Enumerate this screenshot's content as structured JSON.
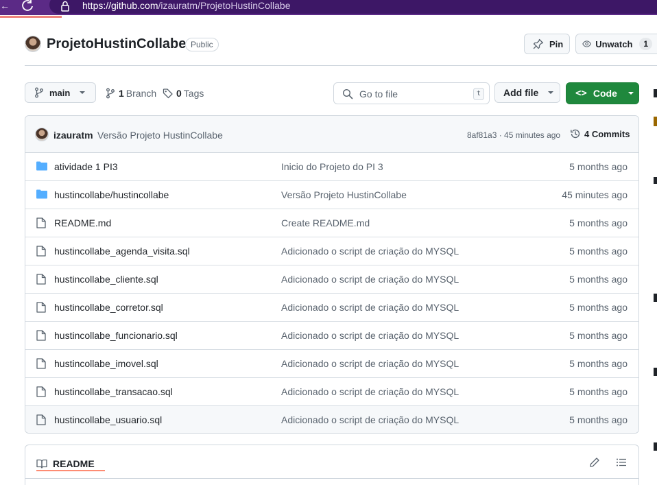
{
  "browser": {
    "url_host": "https://github.com",
    "url_path": "/izauratm/ProjetoHustinCollabe",
    "accent_color": "#5b2a86"
  },
  "repo": {
    "name": "ProjetoHustinCollabe",
    "visibility": "Public",
    "pin_label": "Pin",
    "unwatch_label": "Unwatch",
    "watch_count": "1"
  },
  "toolbar": {
    "branch": "main",
    "branch_count": "1",
    "branch_label": "Branch",
    "tag_count": "0",
    "tag_label": "Tags",
    "goto_placeholder": "Go to file",
    "goto_shortcut": "t",
    "add_file_label": "Add file",
    "code_label": "Code",
    "code_color": "#1f883d"
  },
  "latest_commit": {
    "author": "izauratm",
    "message": "Versão Projeto HustinCollabe",
    "hash_time": "8af81a3 · 45 minutes ago",
    "commits_label": "4 Commits"
  },
  "files": [
    {
      "type": "folder",
      "name": "atividade 1 PI3",
      "commit": "Inicio do Projeto do PI 3",
      "age": "5 months ago"
    },
    {
      "type": "folder",
      "name": "hustincollabe/hustincollabe",
      "commit": "Versão Projeto HustinCollabe",
      "age": "45 minutes ago"
    },
    {
      "type": "file",
      "name": "README.md",
      "commit": "Create README.md",
      "age": "5 months ago"
    },
    {
      "type": "file",
      "name": "hustincollabe_agenda_visita.sql",
      "commit": "Adicionado o script de criação do MYSQL",
      "age": "5 months ago"
    },
    {
      "type": "file",
      "name": "hustincollabe_cliente.sql",
      "commit": "Adicionado o script de criação do MYSQL",
      "age": "5 months ago"
    },
    {
      "type": "file",
      "name": "hustincollabe_corretor.sql",
      "commit": "Adicionado o script de criação do MYSQL",
      "age": "5 months ago"
    },
    {
      "type": "file",
      "name": "hustincollabe_funcionario.sql",
      "commit": "Adicionado o script de criação do MYSQL",
      "age": "5 months ago"
    },
    {
      "type": "file",
      "name": "hustincollabe_imovel.sql",
      "commit": "Adicionado o script de criação do MYSQL",
      "age": "5 months ago"
    },
    {
      "type": "file",
      "name": "hustincollabe_transacao.sql",
      "commit": "Adicionado o script de criação do MYSQL",
      "age": "5 months ago"
    },
    {
      "type": "file",
      "name": "hustincollabe_usuario.sql",
      "commit": "Adicionado o script de criação do MYSQL",
      "age": "5 months ago"
    }
  ],
  "readme": {
    "tab_label": "README"
  }
}
